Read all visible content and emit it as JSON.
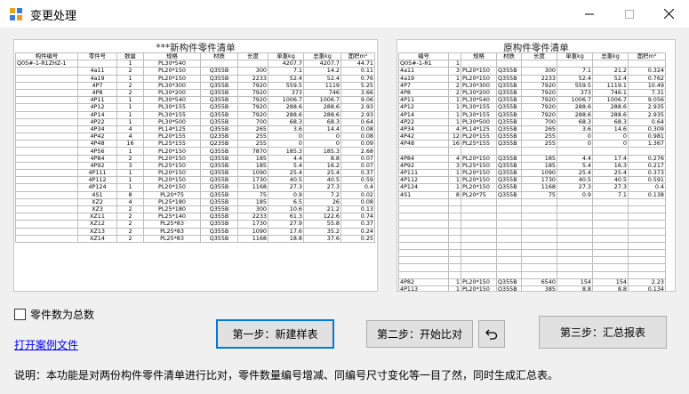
{
  "window": {
    "title": "变更处理"
  },
  "new_list": {
    "title": "***新构件零件清单",
    "headers": [
      "构件编号",
      "零件号",
      "数量",
      "规格",
      "材质",
      "长度",
      "单重kg",
      "总重kg",
      "面积m²"
    ],
    "rows": [
      [
        "Q05#-1-R1ZHZ-1",
        "",
        "1",
        "PL30*540",
        "",
        "",
        "4207.7",
        "4207.7",
        "44.71"
      ],
      [
        "",
        "4a11",
        "2",
        "PL20*150",
        "Q355B",
        "300",
        "7.1",
        "14.2",
        "0.11"
      ],
      [
        "",
        "4a19",
        "1",
        "PL20*150",
        "Q355B",
        "2233",
        "52.4",
        "52.4",
        "0.76"
      ],
      [
        "",
        "4P7",
        "2",
        "PL30*300",
        "Q355B",
        "7920",
        "559.5",
        "1119",
        "5.25"
      ],
      [
        "",
        "4P8",
        "2",
        "PL30*200",
        "Q355B",
        "7920",
        "373",
        "746",
        "3.66"
      ],
      [
        "",
        "4P11",
        "1",
        "PL30*540",
        "Q355B",
        "7920",
        "1006.7",
        "1006.7",
        "9.06"
      ],
      [
        "",
        "4P12",
        "1",
        "PL30*155",
        "Q355B",
        "7920",
        "288.6",
        "288.6",
        "2.93"
      ],
      [
        "",
        "4P14",
        "1",
        "PL30*155",
        "Q355B",
        "7920",
        "288.6",
        "288.6",
        "2.93"
      ],
      [
        "",
        "4P22",
        "1",
        "PL30*500",
        "Q355B",
        "700",
        "68.3",
        "68.3",
        "0.64"
      ],
      [
        "",
        "4P34",
        "4",
        "PL14*125",
        "Q355B",
        "265",
        "3.6",
        "14.4",
        "0.08"
      ],
      [
        "",
        "4P42",
        "4",
        "PL20*155",
        "Q235B",
        "255",
        "0",
        "0",
        "0.08"
      ],
      [
        "",
        "4P48",
        "16",
        "PL25*155",
        "Q235B",
        "255",
        "0",
        "0",
        "0.09"
      ],
      [
        "",
        "4P56",
        "1",
        "PL20*150",
        "Q355B",
        "7870",
        "185.3",
        "185.3",
        "2.68"
      ],
      [
        "",
        "4P84",
        "2",
        "PL20*150",
        "Q355B",
        "185",
        "4.4",
        "8.8",
        "0.07"
      ],
      [
        "",
        "4P92",
        "3",
        "PL25*150",
        "Q355B",
        "185",
        "5.4",
        "16.2",
        "0.07"
      ],
      [
        "",
        "4P111",
        "1",
        "PL20*150",
        "Q355B",
        "1090",
        "25.4",
        "25.4",
        "0.37"
      ],
      [
        "",
        "4P112",
        "1",
        "PL20*150",
        "Q355B",
        "1730",
        "40.5",
        "40.5",
        "0.59"
      ],
      [
        "",
        "4P124",
        "1",
        "PL20*150",
        "Q355B",
        "1168",
        "27.3",
        "27.3",
        "0.4"
      ],
      [
        "",
        "4S1",
        "8",
        "PL20*75",
        "Q355B",
        "75",
        "0.9",
        "7.2",
        "0.02"
      ],
      [
        "",
        "XZ2",
        "4",
        "PL25*180",
        "Q355B",
        "185",
        "6.5",
        "26",
        "0.08"
      ],
      [
        "",
        "XZ3",
        "2",
        "PL25*180",
        "Q355B",
        "300",
        "10.6",
        "21.2",
        "0.13"
      ],
      [
        "",
        "XZ11",
        "2",
        "PL25*140",
        "Q355B",
        "2233",
        "61.3",
        "122.6",
        "0.74"
      ],
      [
        "",
        "XZ12",
        "2",
        "PL25*83",
        "Q355B",
        "1730",
        "27.9",
        "55.8",
        "0.37"
      ],
      [
        "",
        "XZ13",
        "2",
        "PL25*83",
        "Q355B",
        "1090",
        "17.6",
        "35.2",
        "0.24"
      ],
      [
        "",
        "XZ14",
        "2",
        "PL25*83",
        "Q355B",
        "1168",
        "18.8",
        "37.6",
        "0.25"
      ]
    ]
  },
  "old_list": {
    "title": "原构件零件清单",
    "headers": [
      "编号",
      "",
      "规格",
      "材质",
      "长度",
      "单重kg",
      "总重kg",
      "面积m²"
    ],
    "rows": [
      [
        "Q05#-1-R1",
        "1",
        "",
        "",
        "",
        "",
        "",
        ""
      ],
      [
        "4a11",
        "3",
        "PL20*150",
        "Q355B",
        "300",
        "7.1",
        "21.2",
        "0.324"
      ],
      [
        "4a19",
        "1",
        "PL20*150",
        "Q355B",
        "2233",
        "52.4",
        "52.4",
        "0.762"
      ],
      [
        "4P7",
        "2",
        "PL30*300",
        "Q355B",
        "7920",
        "559.5",
        "1119.1",
        "10.49"
      ],
      [
        "4P8",
        "2",
        "PL30*200",
        "Q355B",
        "7920",
        "373",
        "746.1",
        "7.31"
      ],
      [
        "4P11",
        "1",
        "PL30*540",
        "Q355B",
        "7920",
        "1006.7",
        "1006.7",
        "9.056"
      ],
      [
        "4P12",
        "1",
        "PL30*155",
        "Q355B",
        "7920",
        "288.6",
        "288.6",
        "2.935"
      ],
      [
        "4P14",
        "1",
        "PL30*155",
        "Q355B",
        "7920",
        "288.6",
        "288.6",
        "2.935"
      ],
      [
        "4P22",
        "1",
        "PL30*500",
        "Q355B",
        "700",
        "68.3",
        "68.3",
        "0.64"
      ],
      [
        "4P34",
        "4",
        "PL14*125",
        "Q355B",
        "265",
        "3.6",
        "14.6",
        "0.309"
      ],
      [
        "4P42",
        "12",
        "PL20*155",
        "Q355B",
        "255",
        "0",
        "0",
        "0.981"
      ],
      [
        "4P48",
        "16",
        "PL25*155",
        "Q355B",
        "255",
        "0",
        "0",
        "1.367"
      ],
      [
        "",
        "",
        "",
        "",
        "",
        "",
        "",
        ""
      ],
      [
        "4P84",
        "4",
        "PL20*150",
        "Q355B",
        "185",
        "4.4",
        "17.4",
        "0.276"
      ],
      [
        "4P92",
        "3",
        "PL25*150",
        "Q355B",
        "185",
        "5.4",
        "16.3",
        "0.217"
      ],
      [
        "4P111",
        "1",
        "PL20*150",
        "Q355B",
        "1090",
        "25.4",
        "25.4",
        "0.373"
      ],
      [
        "4P112",
        "1",
        "PL20*150",
        "Q355B",
        "1730",
        "40.5",
        "40.5",
        "0.591"
      ],
      [
        "4P124",
        "1",
        "PL20*150",
        "Q355B",
        "1168",
        "27.3",
        "27.3",
        "0.4"
      ],
      [
        "4S1",
        "8",
        "PL20*75",
        "Q355B",
        "75",
        "0.9",
        "7.1",
        "0.138"
      ],
      [
        "",
        "",
        "",
        "",
        "",
        "",
        "",
        ""
      ],
      [
        "",
        "",
        "",
        "",
        "",
        "",
        "",
        ""
      ],
      [
        "",
        "",
        "",
        "",
        "",
        "",
        "",
        ""
      ],
      [
        "",
        "",
        "",
        "",
        "",
        "",
        "",
        ""
      ],
      [
        "",
        "",
        "",
        "",
        "",
        "",
        "",
        ""
      ],
      [
        "",
        "",
        "",
        "",
        "",
        "",
        "",
        ""
      ],
      [
        "",
        "",
        "",
        "",
        "",
        "",
        "",
        ""
      ],
      [
        "",
        "",
        "",
        "",
        "",
        "",
        "",
        ""
      ],
      [
        "",
        "",
        "",
        "",
        "",
        "",
        "",
        ""
      ],
      [
        "",
        "",
        "",
        "",
        "",
        "",
        "",
        ""
      ],
      [
        "",
        "",
        "",
        "",
        "",
        "",
        "",
        ""
      ],
      [
        "4P82",
        "1",
        "PL20*150",
        "Q355B",
        "6540",
        "154",
        "154",
        "2.23"
      ],
      [
        "4P113",
        "1",
        "PL20*150",
        "Q355B",
        "385",
        "8.8",
        "8.8",
        "0.134"
      ]
    ]
  },
  "controls": {
    "checkbox_label": "零件数为总数",
    "open_example_link": "打开案例文件",
    "step1": "第一步：新建样表",
    "step2": "第二步：开始比对",
    "undo_icon": "undo-icon",
    "step3": "第三步：汇总报表",
    "description": "说明：本功能是对两份构件零件清单进行比对，零件数量编号增减、同编号尺寸变化等一目了然，同时生成汇总表。"
  },
  "colors": {
    "link": "#0000ee",
    "primary_border": "#0078d7"
  }
}
